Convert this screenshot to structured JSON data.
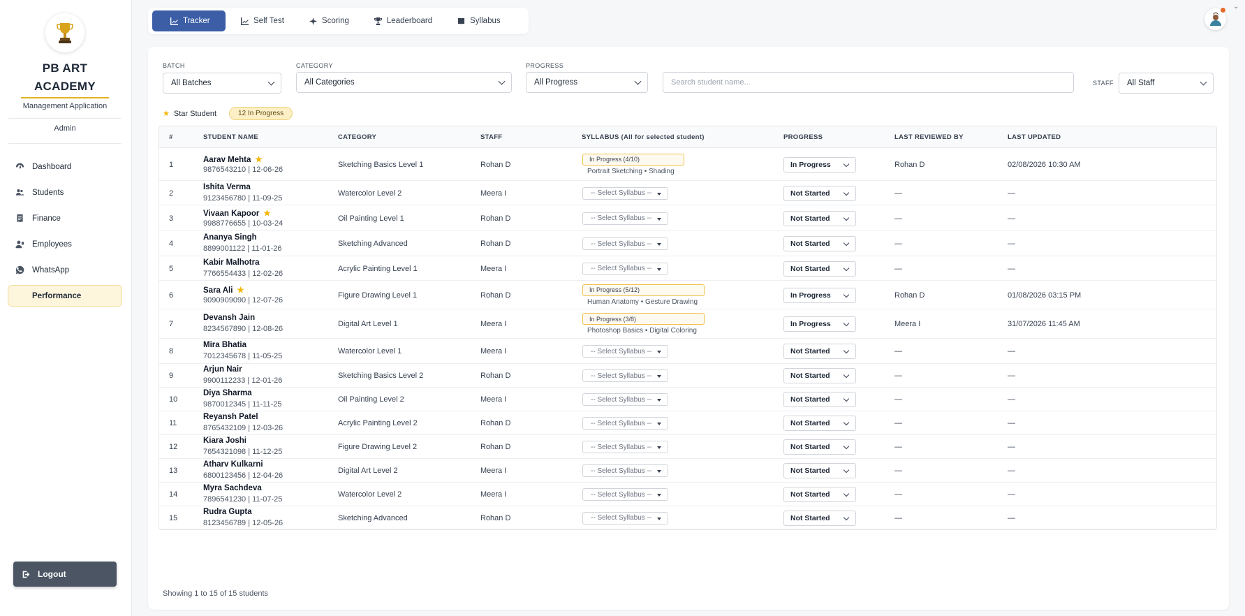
{
  "sidebar": {
    "brand_line1": "PB ART",
    "brand_line2": "ACADEMY",
    "subtitle": "Management Application",
    "role": "Admin",
    "nav": [
      "Dashboard",
      "Students",
      "Finance",
      "Employees",
      "WhatsApp",
      "Performance"
    ],
    "active_nav": "Performance",
    "logout_label": "Logout"
  },
  "tabs": [
    "Tracker",
    "Self Test",
    "Scoring",
    "Leaderboard",
    "Syllabus"
  ],
  "active_tab": "Tracker",
  "filters": {
    "batch_label": "BATCH",
    "batch_value": "All Batches",
    "category_label": "CATEGORY",
    "category_value": "All Categories",
    "progress_label": "PROGRESS",
    "progress_value": "All Progress",
    "search_placeholder": "Search student name...",
    "staff_label": "STAFF",
    "staff_value": "All Staff"
  },
  "legend": {
    "star_label": "Star Student",
    "in_progress_badge": "12 In Progress"
  },
  "table": {
    "headers": [
      "#",
      "STUDENT NAME",
      "CATEGORY",
      "STAFF",
      "SYLLABUS (All for selected student)",
      "PROGRESS",
      "LAST REVIEWED BY",
      "LAST UPDATED"
    ],
    "select_placeholder": "-- Select Syllabus --",
    "rows": [
      {
        "n": "1",
        "name": "Aarav Mehta",
        "star": true,
        "phone": "9876543210 | 12-06-26",
        "category": "Sketching Basics Level 1",
        "staff": "Rohan D",
        "syllabus": "In Progress (4/10)",
        "topics": "Portrait Sketching • Shading",
        "progress": "In Progress",
        "reviewed": "Rohan D",
        "updated": "02/08/2026 10:30 AM"
      },
      {
        "n": "2",
        "name": "Ishita Verma",
        "star": false,
        "phone": "9123456780 | 11-09-25",
        "category": "Watercolor Level 2",
        "staff": "Meera I",
        "syllabus": "",
        "topics": "",
        "progress": "Not Started",
        "reviewed": "—",
        "updated": "—"
      },
      {
        "n": "3",
        "name": "Vivaan Kapoor",
        "star": true,
        "phone": "9988776655 | 10-03-24",
        "category": "Oil Painting Level 1",
        "staff": "Rohan D",
        "syllabus": "",
        "topics": "",
        "progress": "Not Started",
        "reviewed": "—",
        "updated": "—"
      },
      {
        "n": "4",
        "name": "Ananya Singh",
        "star": false,
        "phone": "8899001122 | 11-01-26",
        "category": "Sketching Advanced",
        "staff": "Rohan D",
        "syllabus": "",
        "topics": "",
        "progress": "Not Started",
        "reviewed": "—",
        "updated": "—"
      },
      {
        "n": "5",
        "name": "Kabir Malhotra",
        "star": false,
        "phone": "7766554433 | 12-02-26",
        "category": "Acrylic Painting Level 1",
        "staff": "Meera I",
        "syllabus": "",
        "topics": "",
        "progress": "Not Started",
        "reviewed": "—",
        "updated": "—"
      },
      {
        "n": "6",
        "name": "Sara Ali",
        "star": true,
        "phone": "9090909090 | 12-07-26",
        "category": "Figure Drawing Level 1",
        "staff": "Rohan D",
        "syllabus": "In Progress (5/12)",
        "topics": "Human Anatomy • Gesture Drawing",
        "progress": "In Progress",
        "reviewed": "Rohan D",
        "updated": "01/08/2026 03:15 PM"
      },
      {
        "n": "7",
        "name": "Devansh Jain",
        "star": false,
        "phone": "8234567890 | 12-08-26",
        "category": "Digital Art Level 1",
        "staff": "Meera I",
        "syllabus": "In Progress (3/8)",
        "topics": "Photoshop Basics • Digital Coloring",
        "progress": "In Progress",
        "reviewed": "Meera I",
        "updated": "31/07/2026 11:45 AM"
      },
      {
        "n": "8",
        "name": "Mira Bhatia",
        "star": false,
        "phone": "7012345678 | 11-05-25",
        "category": "Watercolor Level 1",
        "staff": "Meera I",
        "syllabus": "",
        "topics": "",
        "progress": "Not Started",
        "reviewed": "—",
        "updated": "—"
      },
      {
        "n": "9",
        "name": "Arjun Nair",
        "star": false,
        "phone": "9900112233 | 12-01-26",
        "category": "Sketching Basics Level 2",
        "staff": "Rohan D",
        "syllabus": "",
        "topics": "",
        "progress": "Not Started",
        "reviewed": "—",
        "updated": "—"
      },
      {
        "n": "10",
        "name": "Diya Sharma",
        "star": false,
        "phone": "9870012345 | 11-11-25",
        "category": "Oil Painting Level 2",
        "staff": "Meera I",
        "syllabus": "",
        "topics": "",
        "progress": "Not Started",
        "reviewed": "—",
        "updated": "—"
      },
      {
        "n": "11",
        "name": "Reyansh Patel",
        "star": false,
        "phone": "8765432109 | 12-03-26",
        "category": "Acrylic Painting Level 2",
        "staff": "Rohan D",
        "syllabus": "",
        "topics": "",
        "progress": "Not Started",
        "reviewed": "—",
        "updated": "—"
      },
      {
        "n": "12",
        "name": "Kiara Joshi",
        "star": false,
        "phone": "7654321098 | 11-12-25",
        "category": "Figure Drawing Level 2",
        "staff": "Rohan D",
        "syllabus": "",
        "topics": "",
        "progress": "Not Started",
        "reviewed": "—",
        "updated": "—"
      },
      {
        "n": "13",
        "name": "Atharv Kulkarni",
        "star": false,
        "phone": "6800123456 | 12-04-26",
        "category": "Digital Art Level 2",
        "staff": "Meera I",
        "syllabus": "",
        "topics": "",
        "progress": "Not Started",
        "reviewed": "—",
        "updated": "—"
      },
      {
        "n": "14",
        "name": "Myra Sachdeva",
        "star": false,
        "phone": "7896541230 | 11-07-25",
        "category": "Watercolor Level 2",
        "staff": "Meera I",
        "syllabus": "",
        "topics": "",
        "progress": "Not Started",
        "reviewed": "—",
        "updated": "—"
      },
      {
        "n": "15",
        "name": "Rudra Gupta",
        "star": false,
        "phone": "8123456789 | 12-05-26",
        "category": "Sketching Advanced",
        "staff": "Rohan D",
        "syllabus": "",
        "topics": "",
        "progress": "Not Started",
        "reviewed": "—",
        "updated": "—"
      }
    ]
  },
  "footer": "Showing 1 to 15 of 15 students",
  "colors": {
    "primary": "#3b5ea7",
    "accent": "#f5b400",
    "active_nav_bg": "#fdf5dc"
  }
}
